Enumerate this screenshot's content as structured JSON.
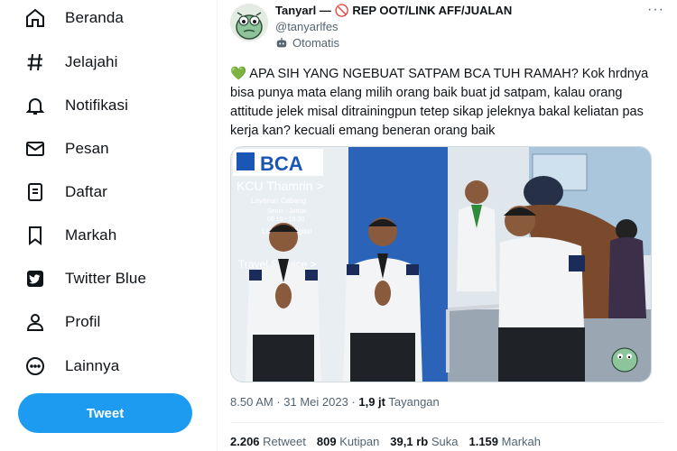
{
  "sidebar": {
    "items": [
      {
        "label": "Beranda",
        "icon": "home-icon"
      },
      {
        "label": "Jelajahi",
        "icon": "hashtag-icon"
      },
      {
        "label": "Notifikasi",
        "icon": "bell-icon"
      },
      {
        "label": "Pesan",
        "icon": "mail-icon"
      },
      {
        "label": "Daftar",
        "icon": "list-icon"
      },
      {
        "label": "Markah",
        "icon": "bookmark-icon"
      },
      {
        "label": "Twitter Blue",
        "icon": "twitter-blue-icon"
      },
      {
        "label": "Profil",
        "icon": "person-icon"
      },
      {
        "label": "Lainnya",
        "icon": "more-circle-icon"
      }
    ],
    "tweet_button": "Tweet"
  },
  "tweet": {
    "author_name": "Tanyarl —",
    "author_name_suffix": "REP OOT/LINK AFF/JUALAN",
    "handle": "@tanyarlfes",
    "automated_label": "Otomatis",
    "more": "···",
    "text": "APA SIH YANG NGEBUAT SATPAM BCA TUH RAMAH? Kok hrdnya bisa punya mata elang milih orang baik buat jd satpam, kalau orang attitude jelek misal ditrainingpun tetep sikap jeleknya bakal keliatan pas kerja kan? kecuali emang beneran orang baik",
    "emoji": "💚",
    "time": "8.50 AM · 31 Mei 2023 · ",
    "views_count": "1,9 jt",
    "views_label": "Tayangan",
    "photo_sign": {
      "brand": "BCA",
      "branch": "KCU Thamrin >",
      "sub": "Layanan Cabang",
      "hours1": "Senin - Jumat",
      "hours2": "08.15 - 15.00",
      "digital": "Layanan Digital",
      "travel": "Travel Service >"
    },
    "stats": [
      {
        "count": "2.206",
        "label": "Retweet"
      },
      {
        "count": "809",
        "label": "Kutipan"
      },
      {
        "count": "39,1 rb",
        "label": "Suka"
      },
      {
        "count": "1.159",
        "label": "Markah"
      }
    ]
  },
  "colors": {
    "accent": "#1d9bf0",
    "text": "#0f1419",
    "muted": "#536471",
    "ban": "#e0245e",
    "heart": "#78b159"
  }
}
